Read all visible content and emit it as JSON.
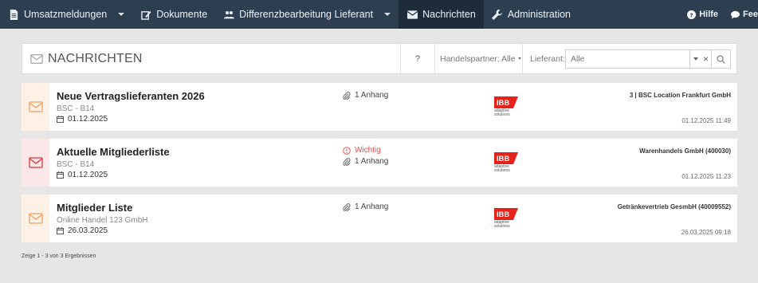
{
  "nav": {
    "items": [
      {
        "label": "Umsatzmeldungen",
        "icon": "document-icon",
        "dropdown": true
      },
      {
        "label": "Dokumente",
        "icon": "edit-icon",
        "dropdown": false
      },
      {
        "label": "Differenzbearbeitung Lieferant",
        "icon": "users-icon",
        "dropdown": true
      },
      {
        "label": "Nachrichten",
        "icon": "envelope-icon",
        "dropdown": false,
        "active": true
      },
      {
        "label": "Administration",
        "icon": "wrench-icon",
        "dropdown": false
      }
    ],
    "right": [
      {
        "label": "Hilfe",
        "icon": "help-icon"
      },
      {
        "label": "Fee",
        "icon": "comment-icon"
      }
    ]
  },
  "header": {
    "title": "NACHRICHTEN",
    "help": "?",
    "handelspartner_label": "Handelspartner: Alle",
    "lieferant_label": "Lieferant:",
    "lieferant_value": "Alle",
    "clear": "×"
  },
  "messages": [
    {
      "title": "Neue Vertragslieferanten 2026",
      "subtitle": "BSC - B14",
      "date": "01.12.2025",
      "important": false,
      "important_label": "",
      "attachments": "1 Anhang",
      "partner": "3 | BSC Location Frankfurt GmbH",
      "timestamp": "01.12.2025 11:49",
      "icon_color": "#f0a060",
      "box_color": "#fdf1e6"
    },
    {
      "title": "Aktuelle Mitgliederliste",
      "subtitle": "BSC - B14",
      "date": "01.12.2025",
      "important": true,
      "important_label": "Wichtig",
      "attachments": "1 Anhang",
      "partner": "Warenhandels GmbH (400030)",
      "timestamp": "01.12.2025 11:23",
      "icon_color": "#d9363e",
      "box_color": "#fbe7e7"
    },
    {
      "title": "Mitglieder Liste",
      "subtitle": "Online Handel 123 GmbH",
      "date": "26.03.2025",
      "important": false,
      "important_label": "",
      "attachments": "1 Anhang",
      "partner": "Getränkevertrieb GesmbH (40009552)",
      "timestamp": "26.03.2025 09:18",
      "icon_color": "#f0a060",
      "box_color": "#fdf1e6"
    }
  ],
  "logo": {
    "text": "IBB",
    "tagline_1": "adaptive",
    "tagline_2": "solutions",
    "color": "#e5231b"
  },
  "footer": {
    "results": "Zeige 1 - 3 von 3 Ergebnissen"
  }
}
